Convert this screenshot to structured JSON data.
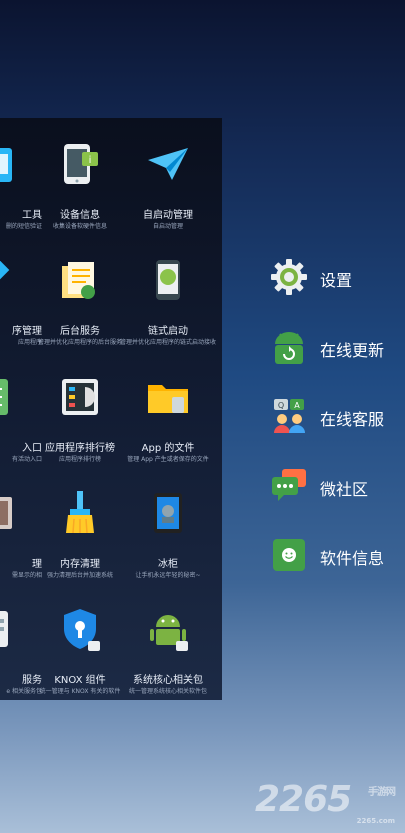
{
  "grid": {
    "items": [
      {
        "title": "工具",
        "sub": "删的短信验证"
      },
      {
        "title": "设备信息",
        "sub": "收集设备软硬件信息"
      },
      {
        "title": "自启动管理",
        "sub": "自启动管理"
      },
      {
        "title": "序管理",
        "sub": "应用程序"
      },
      {
        "title": "后台服务",
        "sub": "管理并优化应用程序的后台服务"
      },
      {
        "title": "链式启动",
        "sub": "管理并优化应用程序的链式启动接收器"
      },
      {
        "title": "入口",
        "sub": "有活动入口"
      },
      {
        "title": "应用程序排行榜",
        "sub": "应用程序排行榜"
      },
      {
        "title": "App 的文件",
        "sub": "管理 App 产生或者保存的文件"
      },
      {
        "title": "理",
        "sub": "需显示的相"
      },
      {
        "title": "内存清理",
        "sub": "强力清理后台并加速系统"
      },
      {
        "title": "冰柜",
        "sub": "让手机永远年轻的秘密~"
      },
      {
        "title": "服务",
        "sub": "e 相关服务包"
      },
      {
        "title": "KNOX 组件",
        "sub": "统一管理与 KNOX 有关的软件"
      },
      {
        "title": "系统核心相关包",
        "sub": "统一管理系统核心相关软件包"
      }
    ]
  },
  "menu": {
    "items": [
      {
        "label": "设置",
        "icon": "gear-icon"
      },
      {
        "label": "在线更新",
        "icon": "android-update-icon"
      },
      {
        "label": "在线客服",
        "icon": "customer-service-icon"
      },
      {
        "label": "微社区",
        "icon": "chat-bubbles-icon"
      },
      {
        "label": "软件信息",
        "icon": "info-smile-icon"
      }
    ]
  },
  "watermark": {
    "main": "2265",
    "brand": "手游网",
    "domain": "2265.com"
  }
}
